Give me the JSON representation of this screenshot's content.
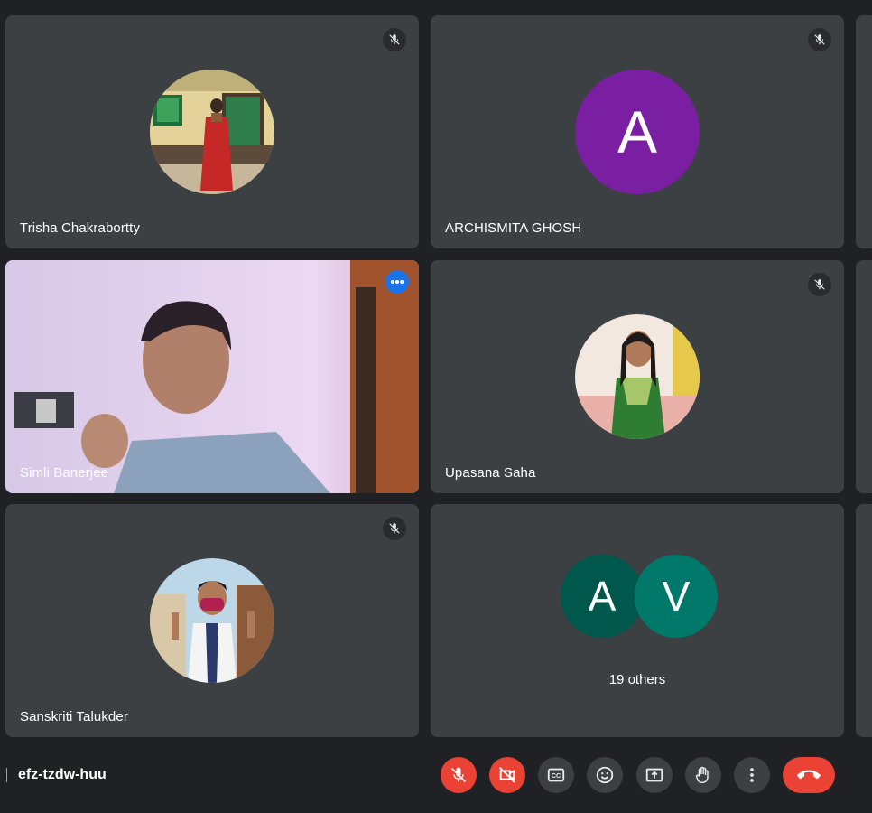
{
  "participants": [
    {
      "name": "Trisha Chakrabortty",
      "muted": true,
      "avatar": "photo"
    },
    {
      "name": "ARCHISMITA GHOSH",
      "muted": true,
      "avatar_letter": "A",
      "avatar_color": "#7b1fa2"
    },
    {
      "name": "Simli Banerjee",
      "muted": false,
      "video": true,
      "active_speaker": true
    },
    {
      "name": "Upasana Saha",
      "muted": true,
      "avatar": "photo"
    },
    {
      "name": "Sanskriti Talukder",
      "muted": true,
      "avatar": "photo"
    }
  ],
  "others": {
    "label": "19 others",
    "avatars": [
      {
        "letter": "A",
        "color": "#00574b"
      },
      {
        "letter": "V",
        "color": "#00796b"
      }
    ]
  },
  "meeting": {
    "code": "efz-tzdw-huu"
  },
  "controls": {
    "mic": "mic-off-icon",
    "camera": "videocam-off-icon",
    "captions": "closed-caption-icon",
    "reactions": "emoji-icon",
    "present": "present-screen-icon",
    "raise_hand": "raise-hand-icon",
    "more": "more-vert-icon",
    "leave": "call-end-icon"
  },
  "colors": {
    "accent_blue": "#8ab4f8",
    "danger": "#ea4335",
    "tile": "#3c4043",
    "bg": "#202124"
  }
}
